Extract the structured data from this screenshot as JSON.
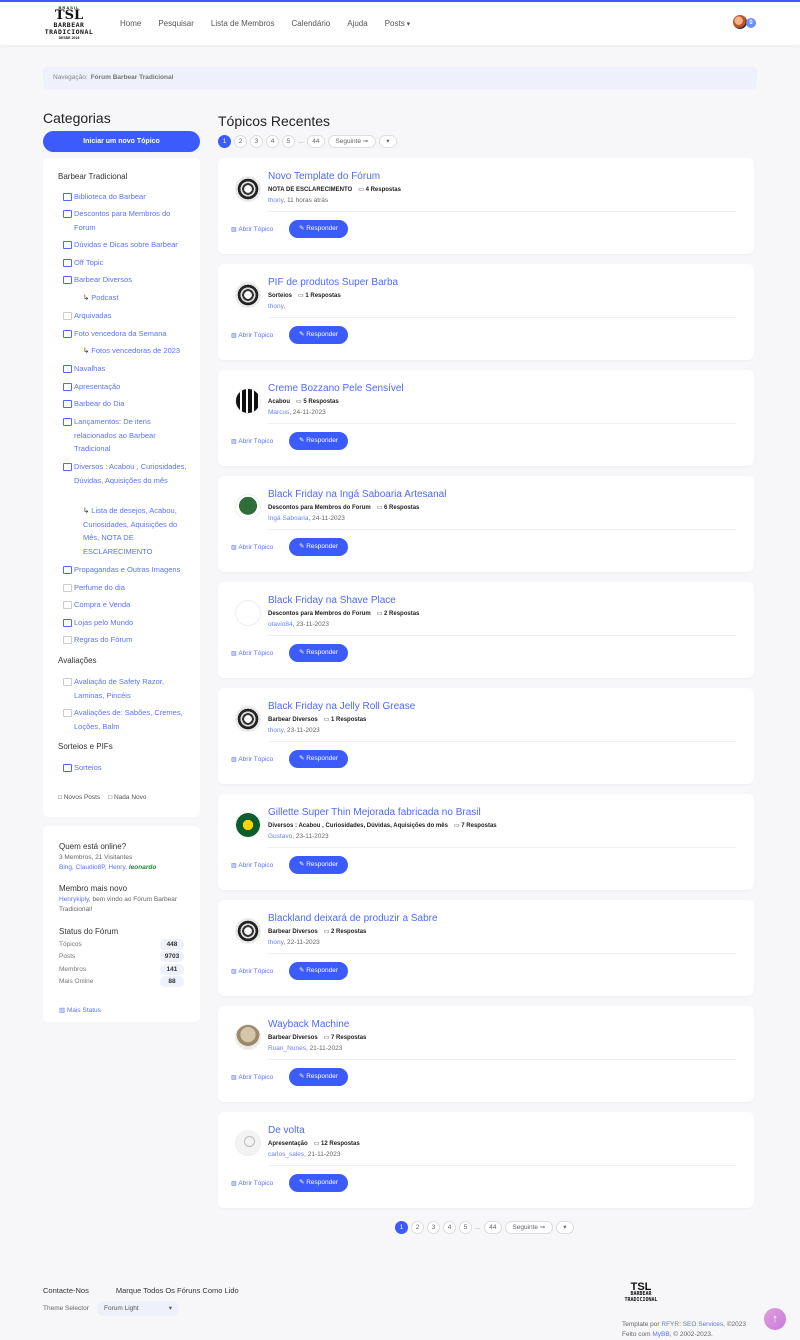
{
  "header": {
    "logo": {
      "top": "BRASIL",
      "mark": "TSL",
      "line1": "BARBEAR",
      "line2": "TRADICIONAL",
      "since": "DESDE 2016"
    },
    "nav": [
      "Home",
      "Pesquisar",
      "Lista de Membros",
      "Calendário",
      "Ajuda",
      "Posts"
    ],
    "notif_count": "0"
  },
  "breadcrumb": {
    "label": "Navegação:",
    "current": "Fórum Barbear Tradicional"
  },
  "sidebar": {
    "title": "Categorias",
    "new_topic": "Iniciar um novo Tópico",
    "groups": [
      {
        "label": "Barbear Tradicional"
      },
      {
        "label": "Avaliações"
      },
      {
        "label": "Sorteios e PIFs"
      }
    ],
    "items": [
      "Biblioteca do Barbear",
      "Descontos para Membros do Forum",
      "Dúvidas e Dicas sobre Barbear",
      "Off Topic",
      "Barbear Diversos",
      "Arquivadas",
      "Foto vencedora da Semana",
      "Navalhas",
      "Apresentação",
      " Barbear do Dia",
      "Lançamentos: De itens relacionados ao Barbear Tradicional",
      "Diversos : Acabou , Curiosidades, Dúvidas, Aquisições do mês",
      "Propagandas e Outras Imagens",
      "Perfume do dia",
      "Compra e Venda",
      "Lojas pelo Mundo",
      "Regras do Fórum",
      "Avaliação de Safety Razor, Laminas, Pincéis",
      "Avaliações de: Sabões, Cremes, Loções, Balm",
      "Sorteios"
    ],
    "subs": [
      "Podcast",
      "Fotos vencedoras de 2023",
      "Lista de desejos, Acabou, Curiosidades, Aquisições do Mês, NOTA DE ESCLARECIMENTO"
    ],
    "legend": [
      "Novos Posts",
      "Nada Novo"
    ]
  },
  "stats": {
    "online_title": "Quem está online?",
    "online_count": "3 Membros, 21 Visitantes",
    "online_users": "Bing, Claudio8P, Henry,",
    "online_highlight": "leonardo",
    "newest_title": "Membro mais novo",
    "newest_user": "Henrykiply",
    "newest_text": ", bem vindo ao Fórum Barbear Tradicional!",
    "status_title": "Status do Fórum",
    "rows": [
      {
        "label": "Tópicos",
        "value": "448"
      },
      {
        "label": "Posts",
        "value": "9703"
      },
      {
        "label": "Membros",
        "value": "141"
      },
      {
        "label": "Mais Online",
        "value": "88"
      }
    ],
    "more": "Mais Status"
  },
  "main": {
    "title": "Tópicos Recentes",
    "pager": {
      "pages": [
        "1",
        "2",
        "3",
        "4",
        "5"
      ],
      "dots": "...",
      "last": "44",
      "next": "Seguinte ➞",
      "menu": "▾"
    },
    "open_label": "Abrir Tópico",
    "reply_label": "Responder",
    "topics": [
      {
        "title": "Novo Template do Fórum",
        "forum": "NOTA DE ESCLARECIMENTO",
        "replies": "4 Respostas",
        "user": "thony",
        "when": ", 11 horas atrás",
        "avatar": "razor"
      },
      {
        "title": "PIF de produtos Super Barba",
        "forum": "Sorteios",
        "replies": "1 Respostas",
        "user": "thony",
        "when": ",",
        "avatar": "razor"
      },
      {
        "title": "Creme Bozzano Pele Sensível",
        "forum": "Acabou",
        "replies": "5 Respostas",
        "user": "Marcus",
        "when": ", 24-11-2023",
        "avatar": "bars"
      },
      {
        "title": "Black Friday na Ingá Saboaria Artesanal",
        "forum": "Descontos para Membros do Forum",
        "replies": "6 Respostas",
        "user": "Ingá Saboaria",
        "when": ", 24-11-2023",
        "avatar": "tree"
      },
      {
        "title": "Black Friday na Shave Place",
        "forum": "Descontos para Membros do Forum",
        "replies": "2 Respostas",
        "user": "otavio84",
        "when": ", 23-11-2023",
        "avatar": "logo"
      },
      {
        "title": "Black Friday na Jelly Roll Grease",
        "forum": "Barbear Diversos",
        "replies": "1 Respostas",
        "user": "thony",
        "when": ", 23-11-2023",
        "avatar": "razor"
      },
      {
        "title": "Gillette Super Thin Mejorada fabricada no Brasil",
        "forum": "Diversos : Acabou , Curiosidades, Dúvidas, Aquisições do mês",
        "replies": "7 Respostas",
        "user": "Gustavo",
        "when": ", 23-11-2023",
        "avatar": "green"
      },
      {
        "title": "Blackland deixará de produzir a Sabre",
        "forum": "Barbear Diversos",
        "replies": "2 Respostas",
        "user": "thony",
        "when": ", 22-11-2023",
        "avatar": "razor"
      },
      {
        "title": "Wayback Machine",
        "forum": "Barbear Diversos",
        "replies": "7 Respostas",
        "user": "Ruan_Nunes",
        "when": ", 21-11-2023",
        "avatar": "dog"
      },
      {
        "title": "De volta",
        "forum": "Apresentação",
        "replies": "12 Respostas",
        "user": "carlos_sales",
        "when": ", 21-11-2023",
        "avatar": "blank"
      }
    ]
  },
  "footer": {
    "contact": "Contacte-Nos",
    "mark_read": "Marque Todos Os Fóruns Como Lido",
    "theme_label": "Theme Selector",
    "theme_value": "Forum Light",
    "credit1_pre": "Template por ",
    "credit1_link": "RFYR: SEO Services",
    "credit1_post": ", ©2023",
    "credit2_pre": "Feito com ",
    "credit2_link": "MyBB",
    "credit2_post": ", © 2002-2023."
  }
}
